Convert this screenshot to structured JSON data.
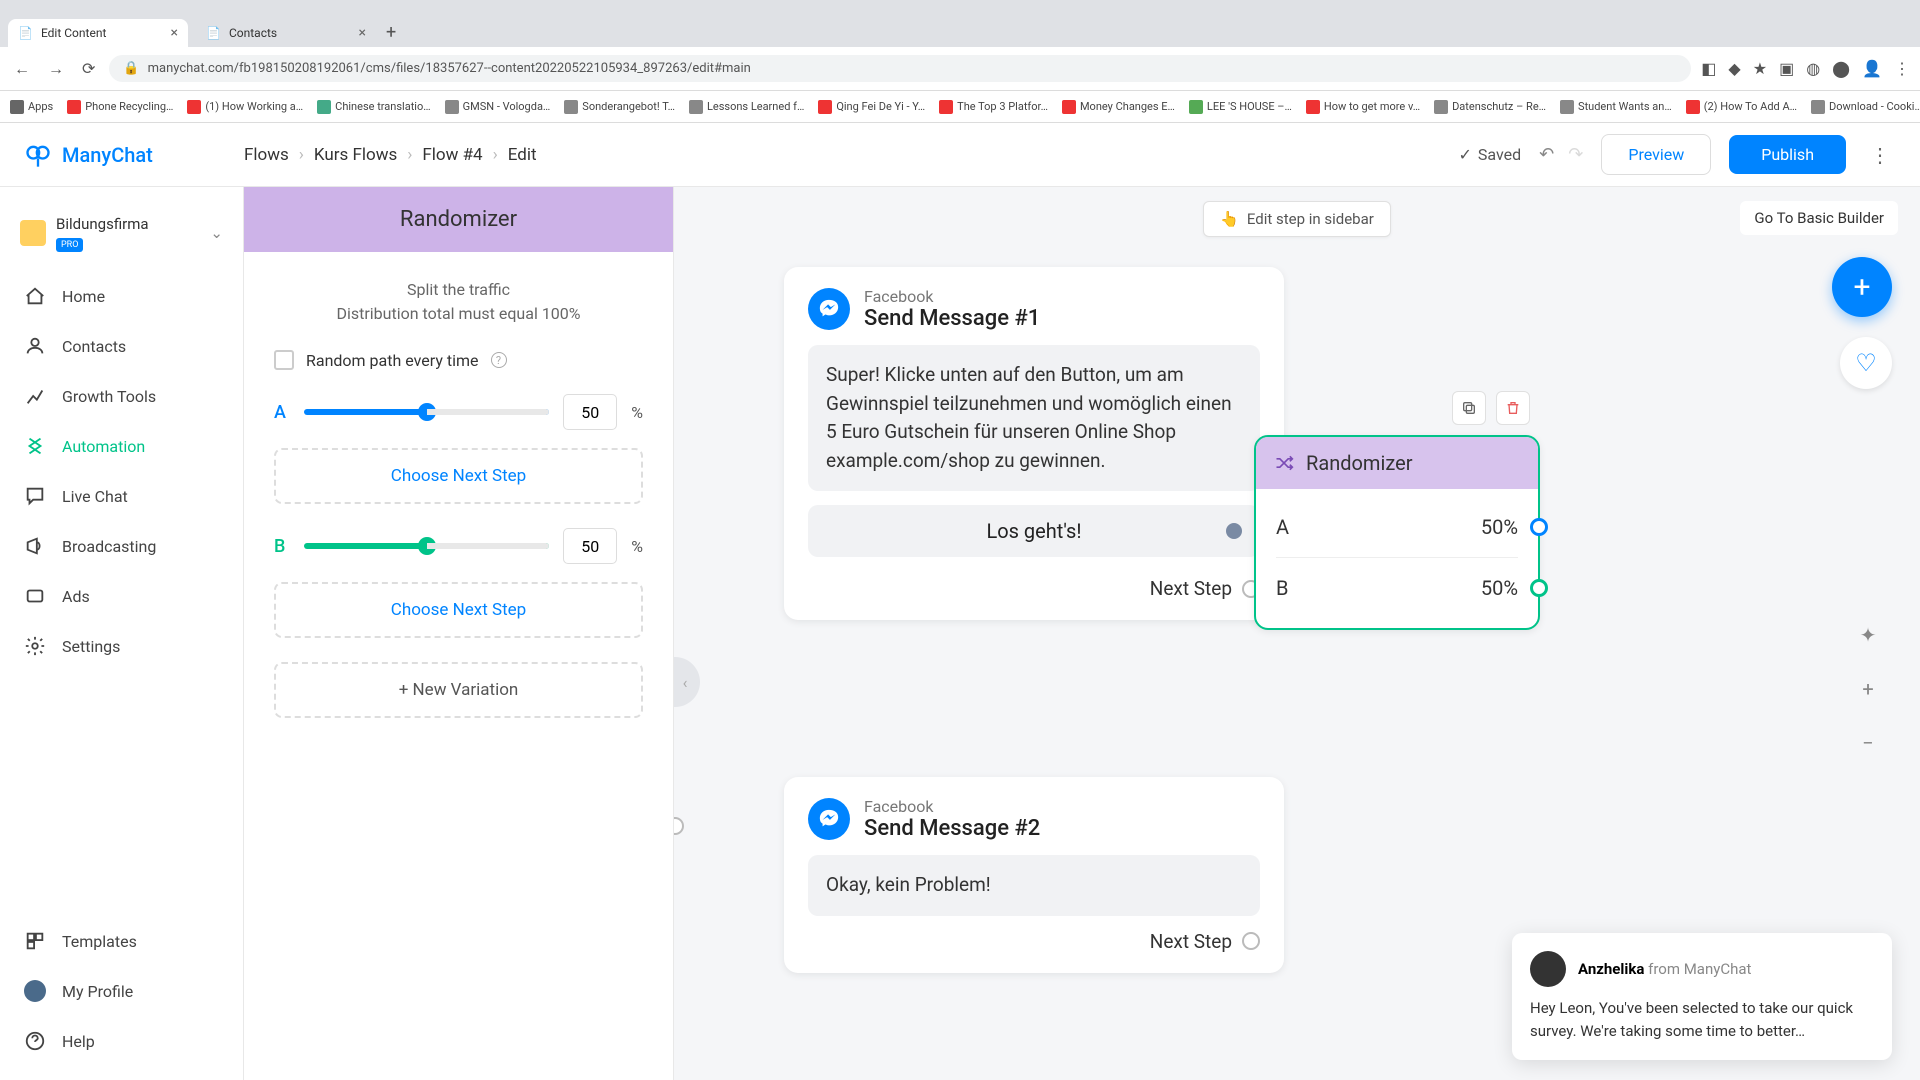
{
  "browser": {
    "tabs": [
      {
        "title": "Edit Content",
        "active": true
      },
      {
        "title": "Contacts",
        "active": false
      }
    ],
    "url": "manychat.com/fb198150208192061/cms/files/18357627--content20220522105934_897263/edit#main",
    "bookmarks": [
      "Apps",
      "Phone Recycling…",
      "(1) How Working a…",
      "Chinese translatio…",
      "GMSN - Vologda…",
      "Sonderangebot! T…",
      "Lessons Learned f…",
      "Qing Fei De Yi - Y…",
      "The Top 3 Platfor…",
      "Money Changes E…",
      "LEE 'S HOUSE –…",
      "How to get more v…",
      "Datenschutz – Re…",
      "Student Wants an…",
      "(2) How To Add A…",
      "Download - Cooki…"
    ]
  },
  "header": {
    "brand": "ManyChat",
    "breadcrumbs": [
      "Flows",
      "Kurs Flows",
      "Flow #4",
      "Edit"
    ],
    "saved": "Saved",
    "preview": "Preview",
    "publish": "Publish"
  },
  "nav": {
    "org": "Bildungsfirma",
    "pro": "PRO",
    "items": [
      "Home",
      "Contacts",
      "Growth Tools",
      "Automation",
      "Live Chat",
      "Broadcasting",
      "Ads",
      "Settings"
    ],
    "bottom": [
      "Templates",
      "My Profile",
      "Help"
    ],
    "active": "Automation"
  },
  "editor": {
    "title": "Randomizer",
    "subtitle1": "Split the traffic",
    "subtitle2": "Distribution total must equal 100%",
    "random_path": "Random path every time",
    "variants": [
      {
        "label": "A",
        "pct": 50
      },
      {
        "label": "B",
        "pct": 50
      }
    ],
    "choose_next": "Choose Next Step",
    "new_variation": "+ New Variation",
    "pct_sym": "%"
  },
  "canvas": {
    "edit_sidebar": "Edit step in sidebar",
    "basic_builder": "Go To Basic Builder",
    "next_step": "Next Step",
    "cards": {
      "msg1": {
        "channel": "Facebook",
        "title": "Send Message #1",
        "text": "Super! Klicke unten auf den Button, um am Gewinnspiel teilzunehmen und womöglich einen 5 Euro Gutschein für unseren Online Shop example.com/shop zu gewinnen.",
        "button": "Los geht's!"
      },
      "msg2": {
        "channel": "Facebook",
        "title": "Send Message #2",
        "text": "Okay, kein Problem!"
      },
      "randomizer": {
        "title": "Randomizer",
        "rows": [
          {
            "label": "A",
            "pct": "50%"
          },
          {
            "label": "B",
            "pct": "50%"
          }
        ]
      }
    }
  },
  "chat": {
    "name": "Anzhelika",
    "from": "from ManyChat",
    "message": "Hey Leon,  You've been selected to take our quick survey. We're taking some time to better…"
  }
}
